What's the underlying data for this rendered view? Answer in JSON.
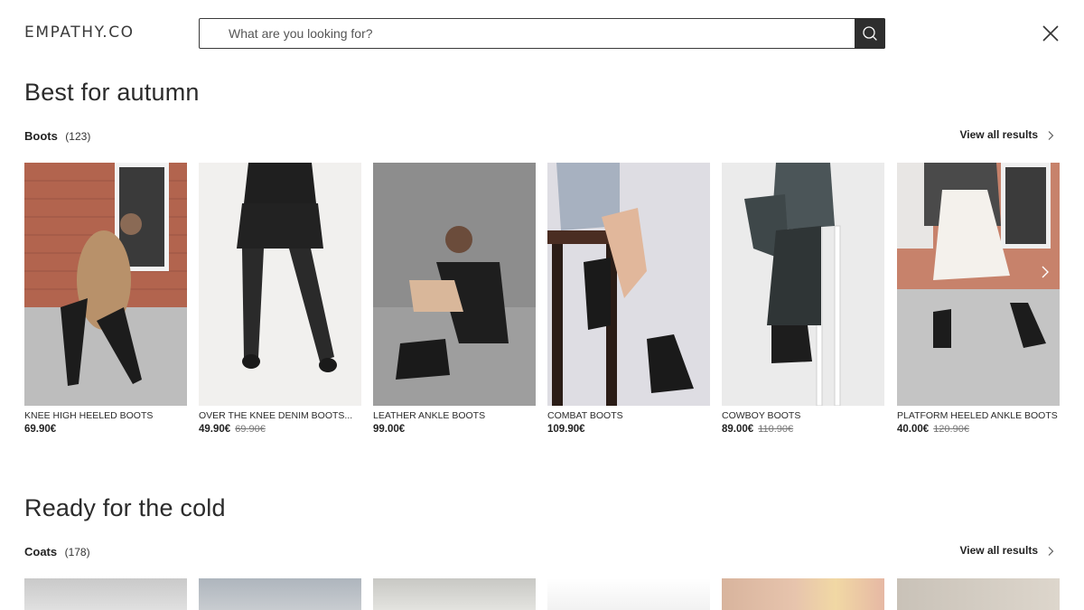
{
  "header": {
    "logo": "empathy.co",
    "search_placeholder": "What are you looking for?"
  },
  "sections": [
    {
      "title": "Best for autumn",
      "category": "Boots",
      "count": "(123)",
      "view_all": "View all results",
      "products": [
        {
          "name": "KNEE HIGH HEELED BOOTS",
          "price": "69.90€",
          "old_price": ""
        },
        {
          "name": "OVER THE KNEE DENIM BOOTS...",
          "price": "49.90€",
          "old_price": "69.90€"
        },
        {
          "name": "LEATHER ANKLE BOOTS",
          "price": "99.00€",
          "old_price": ""
        },
        {
          "name": "COMBAT BOOTS",
          "price": "109.90€",
          "old_price": ""
        },
        {
          "name": "COWBOY BOOTS",
          "price": "89.00€",
          "old_price": "110.90€"
        },
        {
          "name": "PLATFORM HEELED ANKLE BOOTS",
          "price": "40.00€",
          "old_price": "120.90€"
        }
      ]
    },
    {
      "title": "Ready for the cold",
      "category": "Coats",
      "count": "(178)",
      "view_all": "View all results"
    }
  ],
  "icons": {
    "search": "search-icon",
    "close": "close-icon",
    "chevron": "chevron-right-icon"
  },
  "colors": {
    "text": "#2b2b2b",
    "search_button": "#2e2e2e",
    "old_price": "#777777"
  }
}
